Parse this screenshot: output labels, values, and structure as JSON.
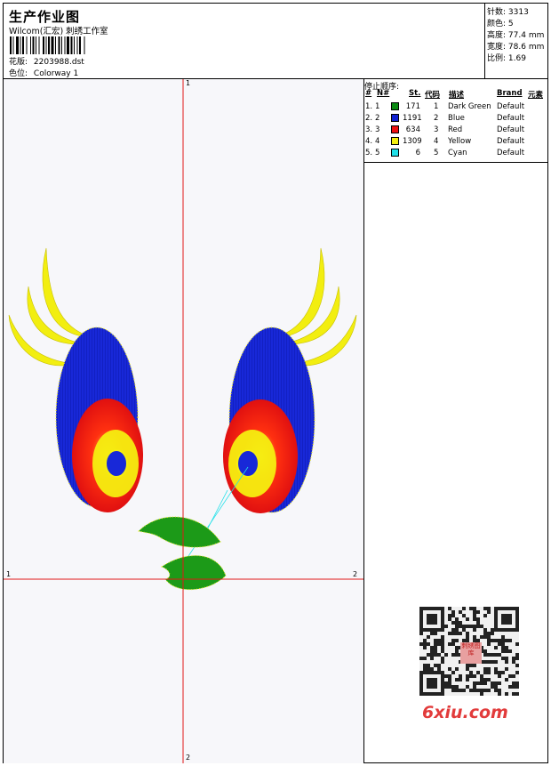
{
  "header": {
    "title": "生产作业图",
    "studio": "Wilcom(汇宏) 刺绣工作室",
    "design_label": "花版:",
    "design_value": "2203988.dst",
    "colorway_label": "色位:",
    "colorway_value": "Colorway 1"
  },
  "stats": [
    {
      "label": "针数:",
      "value": "3313"
    },
    {
      "label": "颜色:",
      "value": "5"
    },
    {
      "label": "高度:",
      "value": "77.4 mm"
    },
    {
      "label": "宽度:",
      "value": "78.6 mm"
    },
    {
      "label": "比例:",
      "value": "1.69"
    }
  ],
  "stop_sequence": {
    "heading": "停止顺序:",
    "columns": [
      "#",
      "N#",
      "St.",
      "代码",
      "描述",
      "Brand",
      "元素"
    ],
    "rows": [
      {
        "idx": "1.",
        "n": "1",
        "st": "171",
        "code": "1",
        "desc": "Dark Green",
        "brand": "Default",
        "color": "#0a8a12"
      },
      {
        "idx": "2.",
        "n": "2",
        "st": "1191",
        "code": "2",
        "desc": "Blue",
        "brand": "Default",
        "color": "#1020d0"
      },
      {
        "idx": "3.",
        "n": "3",
        "st": "634",
        "code": "3",
        "desc": "Red",
        "brand": "Default",
        "color": "#ee1010"
      },
      {
        "idx": "4.",
        "n": "4",
        "st": "1309",
        "code": "4",
        "desc": "Yellow",
        "brand": "Default",
        "color": "#f5f010"
      },
      {
        "idx": "5.",
        "n": "5",
        "st": "6",
        "code": "5",
        "desc": "Cyan",
        "brand": "Default",
        "color": "#20e0e8"
      }
    ]
  },
  "axes": {
    "v_top": "1",
    "v_bottom": "2",
    "h_left": "1",
    "h_right": "2"
  },
  "watermark": {
    "qr_text": "刺绣图库",
    "site": "6xiu.com"
  },
  "colors": {
    "axis": "#e01818",
    "green": "#0a8a12",
    "blue": "#1020d0",
    "red": "#ee1010",
    "yellow": "#f5f010",
    "cyan": "#20e0e8"
  }
}
